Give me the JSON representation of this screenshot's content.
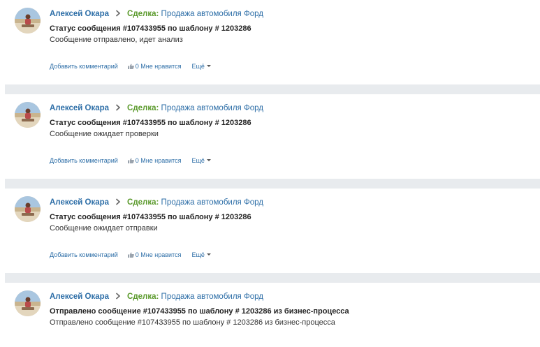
{
  "posts": [
    {
      "author": "Алексей Окара",
      "deal_label": "Сделка:",
      "deal_name": "Продажа автомобиля Форд",
      "title": "Статус сообщения #107433955 по шаблону # 1203286",
      "body": "Сообщение отправлено, идет анализ",
      "comment_label": "Добавить комментарий",
      "likes_count": "0",
      "like_label": "Мне нравится",
      "more_label": "Ещё"
    },
    {
      "author": "Алексей Окара",
      "deal_label": "Сделка:",
      "deal_name": "Продажа автомобиля Форд",
      "title": "Статус сообщения #107433955 по шаблону # 1203286",
      "body": "Сообщение ожидает проверки",
      "comment_label": "Добавить комментарий",
      "likes_count": "0",
      "like_label": "Мне нравится",
      "more_label": "Ещё"
    },
    {
      "author": "Алексей Окара",
      "deal_label": "Сделка:",
      "deal_name": "Продажа автомобиля Форд",
      "title": "Статус сообщения #107433955 по шаблону # 1203286",
      "body": "Сообщение ожидает отправки",
      "comment_label": "Добавить комментарий",
      "likes_count": "0",
      "like_label": "Мне нравится",
      "more_label": "Ещё"
    },
    {
      "author": "Алексей Окара",
      "deal_label": "Сделка:",
      "deal_name": "Продажа автомобиля Форд",
      "title": "Отправлено сообщение #107433955 по шаблону # 1203286 из бизнес-процесса",
      "body": "Отправлено сообщение #107433955 по шаблону # 1203286 из бизнес-процесса"
    }
  ],
  "colors": {
    "link": "#2d6ea7",
    "deal_label": "#5b9a2c",
    "separator": "#e8ebee"
  },
  "icons": {
    "avatar": "avatar-photo",
    "chevron": "chevron-right-icon",
    "like": "thumbs-up-icon",
    "more": "caret-down-icon"
  }
}
